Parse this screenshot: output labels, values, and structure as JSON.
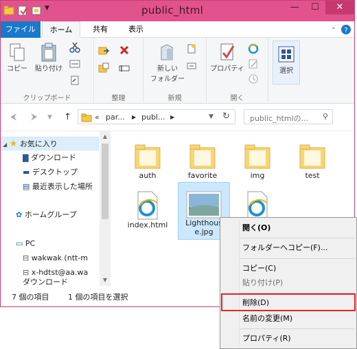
{
  "window": {
    "title": "public_html"
  },
  "tabs": [
    {
      "label": "ファイル"
    },
    {
      "label": "ホーム"
    },
    {
      "label": "共有"
    },
    {
      "label": "表示"
    }
  ],
  "ribbon": {
    "groups": {
      "clipboard": "クリップボード",
      "organize": "整理",
      "new": "新規",
      "open": "開く"
    },
    "buttons": {
      "copy": "コピー",
      "paste": "貼り付け",
      "new_folder_1": "新しい",
      "new_folder_2": "フォルダー",
      "properties": "プロパティ",
      "select": "選択"
    }
  },
  "address": {
    "prefix": "«",
    "crumb1": "par...",
    "crumb2": "publ...",
    "search_placeholder": "public_htmlの..."
  },
  "nav": {
    "favorites": "お気に入り",
    "downloads": "ダウンロード",
    "desktop": "デスクトップ",
    "recent": "最近表示した場所",
    "homegroup": "ホームグループ",
    "pc": "PC",
    "net1": "wakwak (ntt-m",
    "net2": "x-hdtst@aa.wa",
    "net3": "ダウンロード"
  },
  "files": [
    {
      "name": "auth",
      "type": "folder"
    },
    {
      "name": "favorite",
      "type": "folder"
    },
    {
      "name": "img",
      "type": "folder"
    },
    {
      "name": "test",
      "type": "folder"
    },
    {
      "name": "index.html",
      "type": "html"
    },
    {
      "name_line1": "Lighthous",
      "name_line2": "e.jpg",
      "type": "image"
    },
    {
      "name": "",
      "type": "html"
    }
  ],
  "status": {
    "count": "7 個の項目",
    "selected": "1 個の項目を選択"
  },
  "context_menu": {
    "open": "開く(O)",
    "copy_to_folder": "フォルダーへコピー(F)...",
    "copy": "コピー(C)",
    "paste": "貼り付け(P)",
    "delete": "削除(D)",
    "rename": "名前の変更(M)",
    "properties": "プロパティ(R)"
  },
  "colors": {
    "title_bar": "#e2528c",
    "file_tab": "#1979ca",
    "highlight_box": "#e8202a",
    "selection": "#cce8ff"
  }
}
